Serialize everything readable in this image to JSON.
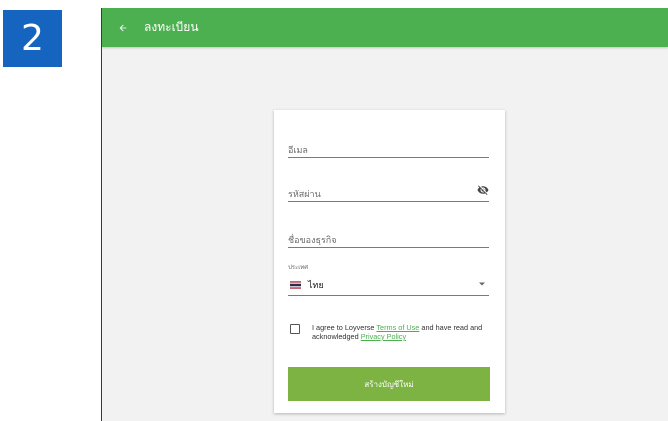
{
  "step": {
    "number": "2"
  },
  "header": {
    "title": "ลงทะเบียน",
    "back_icon": "arrow-left-icon"
  },
  "form": {
    "email_placeholder": "อีเมล",
    "password_placeholder": "รหัสผ่าน",
    "business_placeholder": "ชื่อของธุรกิจ",
    "country_label": "ประเทศ",
    "country_value": "ไทย",
    "agree_prefix": "I agree to Loyverse ",
    "terms_link": "Terms of Use",
    "agree_middle": " and have read and acknowledged ",
    "privacy_link": "Privacy Policy",
    "create_button": "สร้างบัญชีใหม่"
  },
  "colors": {
    "app_bar": "#4caf50",
    "button": "#7cb342",
    "link": "#4caf50",
    "step_badge": "#1565c0"
  },
  "icons": [
    "arrow-left-icon",
    "eye-off-icon",
    "thailand-flag-icon",
    "dropdown-arrow-icon"
  ]
}
